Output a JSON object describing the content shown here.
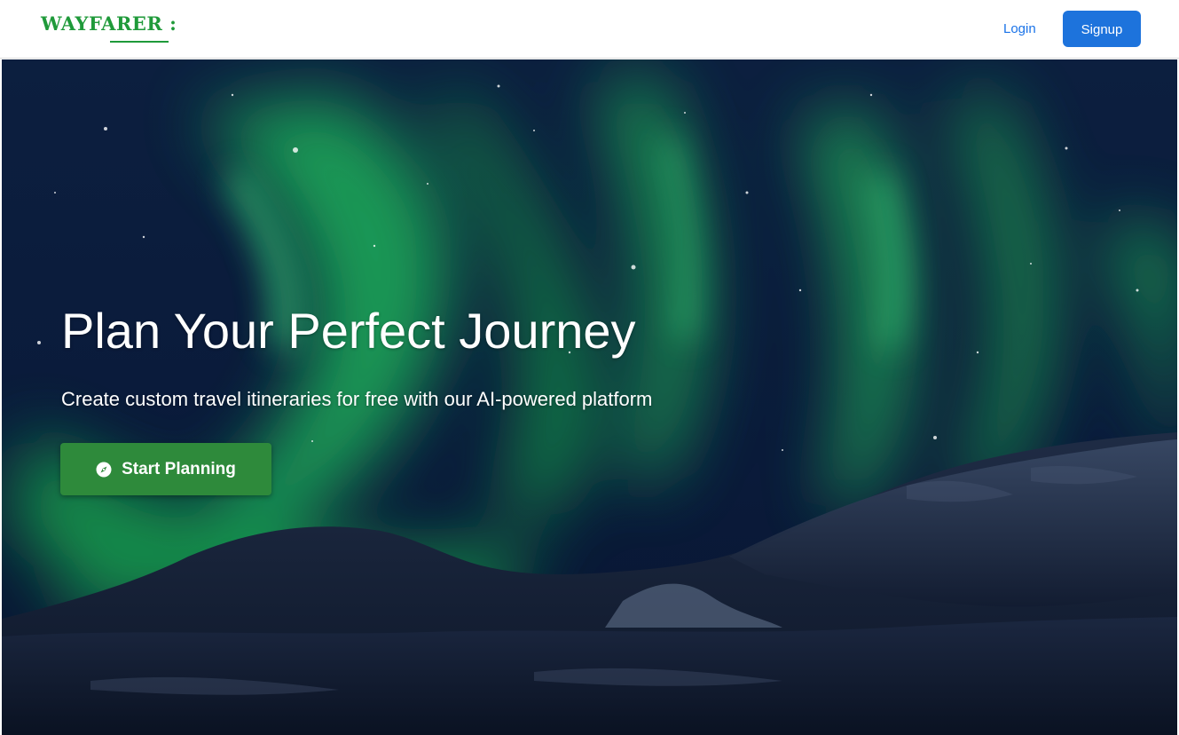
{
  "brand": {
    "logo_text": "WAYFARER :",
    "color": "#1f9a3a"
  },
  "nav": {
    "login_label": "Login",
    "signup_label": "Signup",
    "signup_color": "#1d73dc",
    "login_color": "#1a73e8"
  },
  "hero": {
    "title": "Plan Your Perfect Journey",
    "subtitle": "Create custom travel itineraries for free with our AI-powered platform",
    "cta_label": "Start Planning",
    "cta_icon": "compass-icon",
    "cta_color": "#2e8a3b",
    "background": "aurora-night-sky-mountains"
  }
}
